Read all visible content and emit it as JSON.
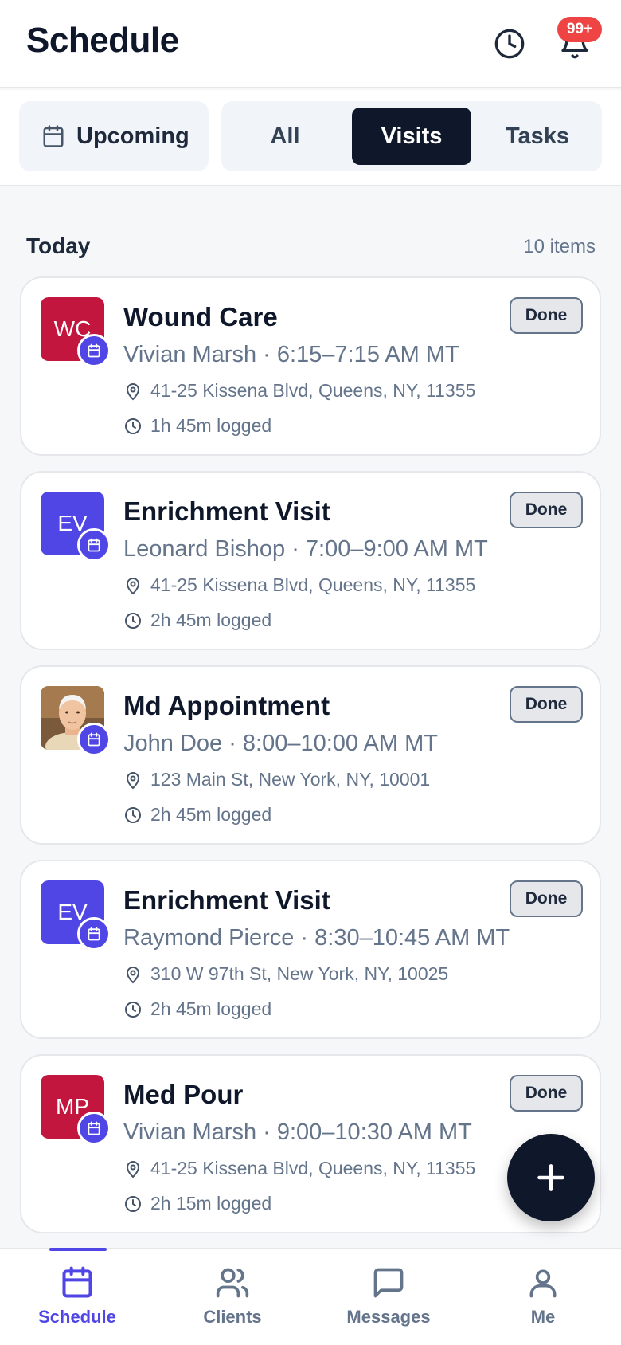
{
  "header": {
    "title": "Schedule",
    "notification_count": "99+"
  },
  "filters": {
    "upcoming_label": "Upcoming",
    "segments": [
      "All",
      "Visits",
      "Tasks"
    ],
    "selected": "Visits"
  },
  "section": {
    "title": "Today",
    "count": "10 items"
  },
  "visits": [
    {
      "initials": "WC",
      "avatar_color": "#c2163e",
      "title": "Wound Care",
      "subtitle": "Vivian Marsh · 6:15–7:15 AM MT",
      "address": "41-25 Kissena Blvd, Queens, NY, 11355",
      "logged": "1h 45m logged",
      "status": "Done"
    },
    {
      "initials": "EV",
      "avatar_color": "#4f46e5",
      "title": "Enrichment Visit",
      "subtitle": "Leonard Bishop · 7:00–9:00 AM MT",
      "address": "41-25 Kissena Blvd, Queens, NY, 11355",
      "logged": "2h 45m logged",
      "status": "Done"
    },
    {
      "initials": "",
      "avatar_color": "#c9a27a",
      "title": "Md Appointment",
      "subtitle": "John Doe · 8:00–10:00 AM MT",
      "address": "123 Main St, New York, NY, 10001",
      "logged": "2h 45m logged",
      "status": "Done"
    },
    {
      "initials": "EV",
      "avatar_color": "#4f46e5",
      "title": "Enrichment Visit",
      "subtitle": "Raymond Pierce · 8:30–10:45 AM MT",
      "address": "310 W 97th St, New York, NY, 10025",
      "logged": "2h 45m logged",
      "status": "Done"
    },
    {
      "initials": "MP",
      "avatar_color": "#c2163e",
      "title": "Med Pour",
      "subtitle": "Vivian Marsh · 9:00–10:30 AM MT",
      "address": "41-25 Kissena Blvd, Queens, NY, 11355",
      "logged": "2h 15m logged",
      "status": "Done"
    }
  ],
  "nav": {
    "items": [
      {
        "label": "Schedule",
        "icon": "calendar-icon",
        "active": true
      },
      {
        "label": "Clients",
        "icon": "users-icon",
        "active": false
      },
      {
        "label": "Messages",
        "icon": "message-icon",
        "active": false
      },
      {
        "label": "Me",
        "icon": "user-icon",
        "active": false
      }
    ]
  },
  "colors": {
    "accent": "#4f46e5",
    "dark": "#0f172a",
    "danger": "#ef4444"
  }
}
